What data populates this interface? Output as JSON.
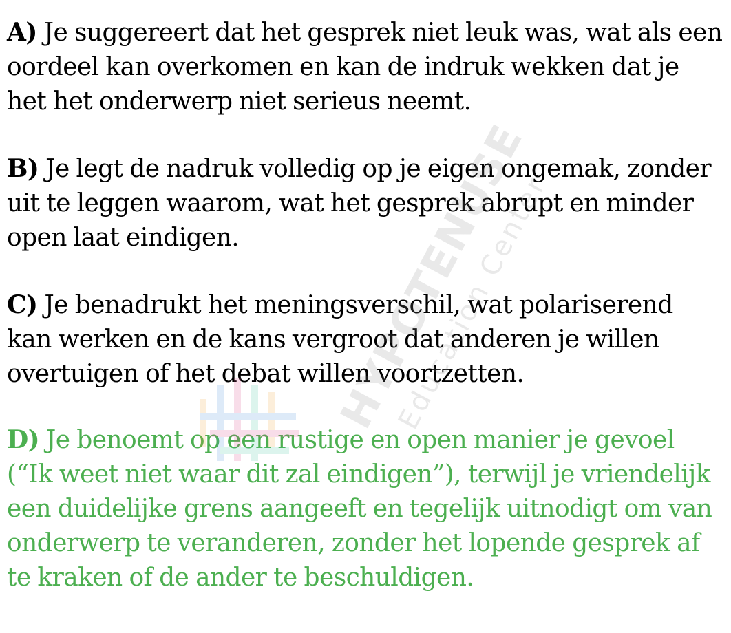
{
  "options": [
    {
      "letter": "A)",
      "text": " Je suggereert dat het gesprek niet leuk was, wat als een oordeel kan overkomen en kan de indruk wekken dat je het het onderwerp niet serieus neemt.",
      "correct": false
    },
    {
      "letter": "B)",
      "text": " Je legt de nadruk volledig op je eigen ongemak, zonder uit te leggen waarom, wat het gesprek abrupt en minder open laat eindigen.",
      "correct": false
    },
    {
      "letter": "C)",
      "text": " Je benadrukt het meningsverschil, wat polariserend kan werken en de kans vergroot dat anderen je willen overtuigen of het debat willen voortzetten.",
      "correct": false
    },
    {
      "letter": "D)",
      "text": " Je benoemt op een rustige en open manier je gevoel (“Ik weet niet waar dit zal eindigen”), terwijl je vriendelijk een duidelijke grens aangeeft en tegelijk uitnodigt om van onderwerp te veranderen, zonder het lopende gesprek af te kraken of de ander te beschuldigen.",
      "correct": true
    }
  ],
  "colors": {
    "text": "#000000",
    "correct": "#4caf50"
  },
  "watermark": {
    "brand": "HYPOTENUSE",
    "tagline": "Education Center",
    "logo_icon": "hypotenuse-logo-icon"
  }
}
